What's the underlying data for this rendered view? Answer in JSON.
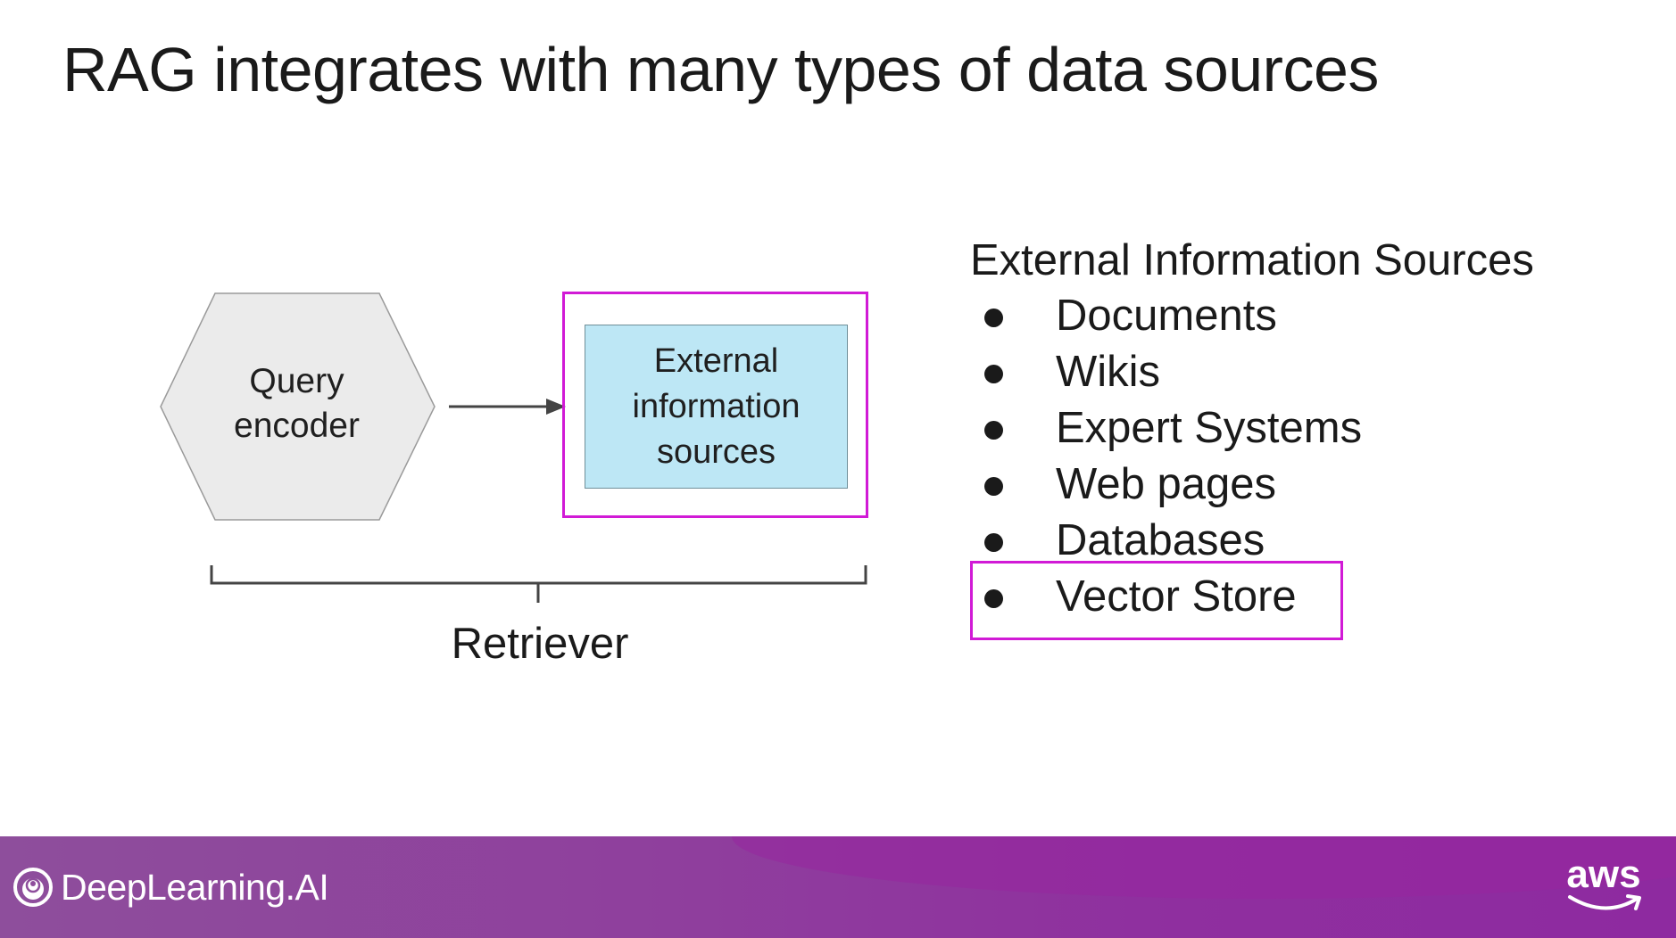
{
  "slide": {
    "title": "RAG integrates with many types of data sources"
  },
  "diagram": {
    "query_encoder": {
      "line1": "Query",
      "line2": "encoder"
    },
    "external_sources_box": {
      "line1": "External",
      "line2": "information",
      "line3": "sources"
    },
    "retriever_label": "Retriever"
  },
  "sources_list": {
    "heading": "External Information Sources",
    "items": [
      "Documents",
      "Wikis",
      "Expert Systems",
      "Web pages",
      "Databases",
      "Vector Store"
    ],
    "highlighted_item": "Vector Store"
  },
  "footer": {
    "brand": "DeepLearning.AI",
    "partner_logo_text": "aws"
  },
  "colors": {
    "highlight": "#d11ad6",
    "hexagon_fill": "#ebebeb",
    "sources_box_fill": "#bde7f5",
    "footer_gradient_start": "#8e4e9c",
    "footer_gradient_end": "#8e2aa0"
  },
  "icons": {
    "brand_logo": "deeplearning-ai-logo-icon",
    "partner_logo": "aws-smile-icon"
  }
}
